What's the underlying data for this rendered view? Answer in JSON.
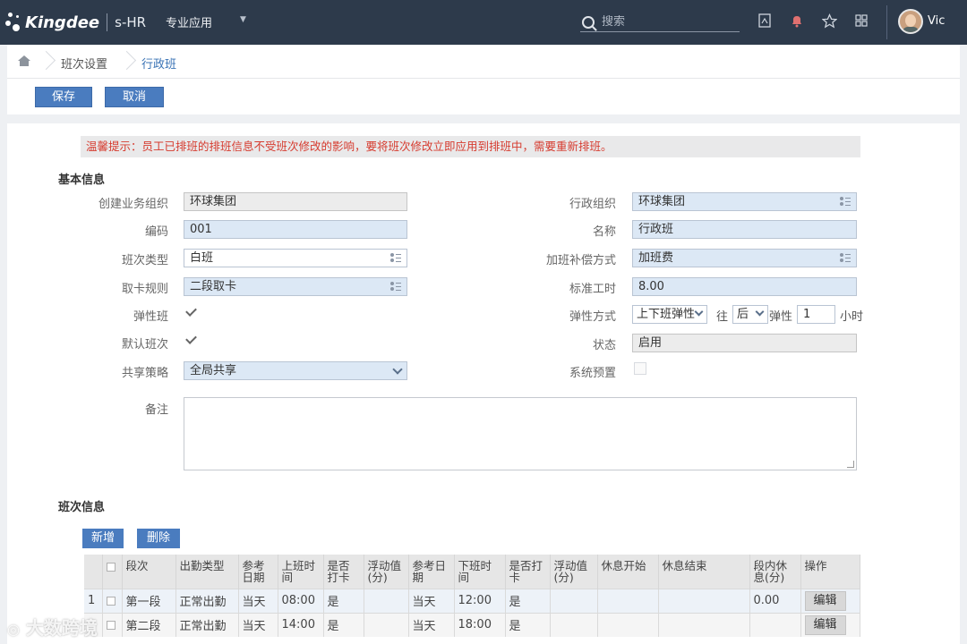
{
  "topbar": {
    "logo_text": "Kingdee",
    "product": "s-HR",
    "nav_item": "专业应用",
    "search_placeholder": "搜索",
    "username": "Vic"
  },
  "breadcrumb": {
    "items": [
      "班次设置",
      "行政班"
    ]
  },
  "toolbar": {
    "save_label": "保存",
    "cancel_label": "取消"
  },
  "notice": "温馨提示：员工已排班的排班信息不受班次修改的影响，要将班次修改立即应用到排班中，需要重新排班。",
  "basic_info": {
    "title": "基本信息",
    "left": [
      {
        "label": "创建业务组织",
        "value": "环球集团"
      },
      {
        "label": "编码",
        "value": "001"
      },
      {
        "label": "班次类型",
        "value": "白班"
      },
      {
        "label": "取卡规则",
        "value": "二段取卡"
      },
      {
        "label": "弹性班",
        "checked": true
      },
      {
        "label": "默认班次",
        "checked": true
      },
      {
        "label": "共享策略",
        "value": "全局共享"
      },
      {
        "label": "备注",
        "value": ""
      }
    ],
    "right": [
      {
        "label": "行政组织",
        "value": "环球集团"
      },
      {
        "label": "名称",
        "value": "行政班"
      },
      {
        "label": "加班补偿方式",
        "value": "加班费"
      },
      {
        "label": "标准工时",
        "value": "8.00"
      },
      {
        "label": "弹性方式",
        "value": "上下班弹性",
        "dir_label": "往",
        "dir_value": "后",
        "elastic_label": "弹性",
        "elastic_value": "1",
        "unit": "小时"
      },
      {
        "label": "状态",
        "value": "启用"
      },
      {
        "label": "系统预置",
        "checked": false
      }
    ]
  },
  "shift_info": {
    "title": "班次信息",
    "add_label": "新增",
    "delete_label": "删除",
    "columns": [
      "段次",
      "出勤类型",
      "参考日期",
      "上班时间",
      "是否打卡",
      "浮动值(分)",
      "参考日期",
      "下班时间",
      "是否打卡",
      "浮动值(分)",
      "休息开始",
      "休息结束",
      "段内休息(分)",
      "操作"
    ],
    "rows": [
      {
        "index": "1",
        "cells": [
          "第一段",
          "正常出勤",
          "当天",
          "08:00",
          "是",
          "",
          "当天",
          "12:00",
          "是",
          "",
          "",
          "",
          "0.00"
        ],
        "action": "编辑"
      },
      {
        "index": "",
        "cells": [
          "第二段",
          "正常出勤",
          "当天",
          "14:00",
          "是",
          "",
          "当天",
          "18:00",
          "是",
          "",
          "",
          "",
          ""
        ],
        "action": "编辑"
      }
    ]
  },
  "watermark": "大数跨境"
}
